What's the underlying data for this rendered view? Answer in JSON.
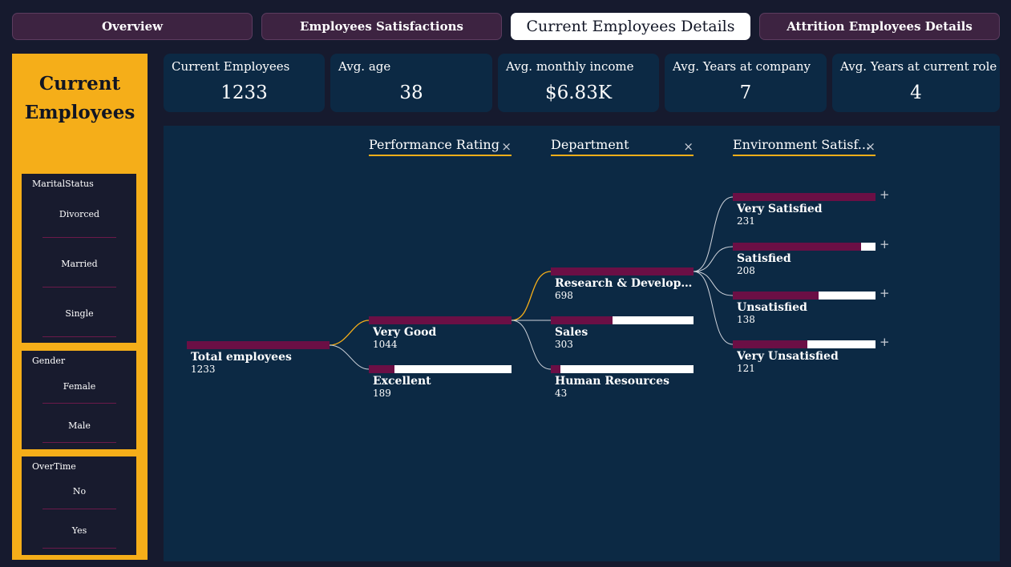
{
  "tabs": [
    {
      "label": "Overview",
      "active": false
    },
    {
      "label": "Employees Satisfactions",
      "active": false
    },
    {
      "label": "Current Employees Details",
      "active": true
    },
    {
      "label": "Attrition Employees Details",
      "active": false
    }
  ],
  "left_panel": {
    "title_line1": "Current",
    "title_line2": "Employees",
    "slicers": {
      "marital": {
        "title": "MaritalStatus",
        "items": [
          "Divorced",
          "Married",
          "Single"
        ]
      },
      "gender": {
        "title": "Gender",
        "items": [
          "Female",
          "Male"
        ]
      },
      "overtime": {
        "title": "OverTime",
        "items": [
          "No",
          "Yes"
        ]
      }
    }
  },
  "kpis": [
    {
      "label": "Current Employees",
      "value": "1233"
    },
    {
      "label": "Avg. age",
      "value": "38"
    },
    {
      "label": "Avg. monthly income",
      "value": "$6.83K"
    },
    {
      "label": "Avg. Years at company",
      "value": "7"
    },
    {
      "label": "Avg. Years at current role",
      "value": "4"
    }
  ],
  "tree": {
    "levels": [
      "Performance Rating",
      "Department",
      "Environment Satisf..."
    ],
    "close_icon": "×",
    "expand_icon": "+",
    "root": {
      "label": "Total employees",
      "count": "1233",
      "fraction": 1.0
    },
    "performance": [
      {
        "label": "Very Good",
        "count": "1044",
        "fraction": 1.0
      },
      {
        "label": "Excellent",
        "count": "189",
        "fraction": 0.18
      }
    ],
    "department": [
      {
        "label": "Research & Development",
        "count": "698",
        "fraction": 1.0
      },
      {
        "label": "Sales",
        "count": "303",
        "fraction": 0.43
      },
      {
        "label": "Human Resources",
        "count": "43",
        "fraction": 0.07
      }
    ],
    "environment": [
      {
        "label": "Very Satisfied",
        "count": "231",
        "fraction": 1.0
      },
      {
        "label": "Satisfied",
        "count": "208",
        "fraction": 0.9
      },
      {
        "label": "Unsatisfied",
        "count": "138",
        "fraction": 0.6
      },
      {
        "label": "Very Unsatisfied",
        "count": "121",
        "fraction": 0.52
      }
    ]
  },
  "colors": {
    "background": "#161a2e",
    "panel_accent": "#f5ae19",
    "card": "#0c2944",
    "bar_fill": "#6b0f45",
    "active_path": "#f5ae19",
    "link": "#d0d4dc"
  }
}
